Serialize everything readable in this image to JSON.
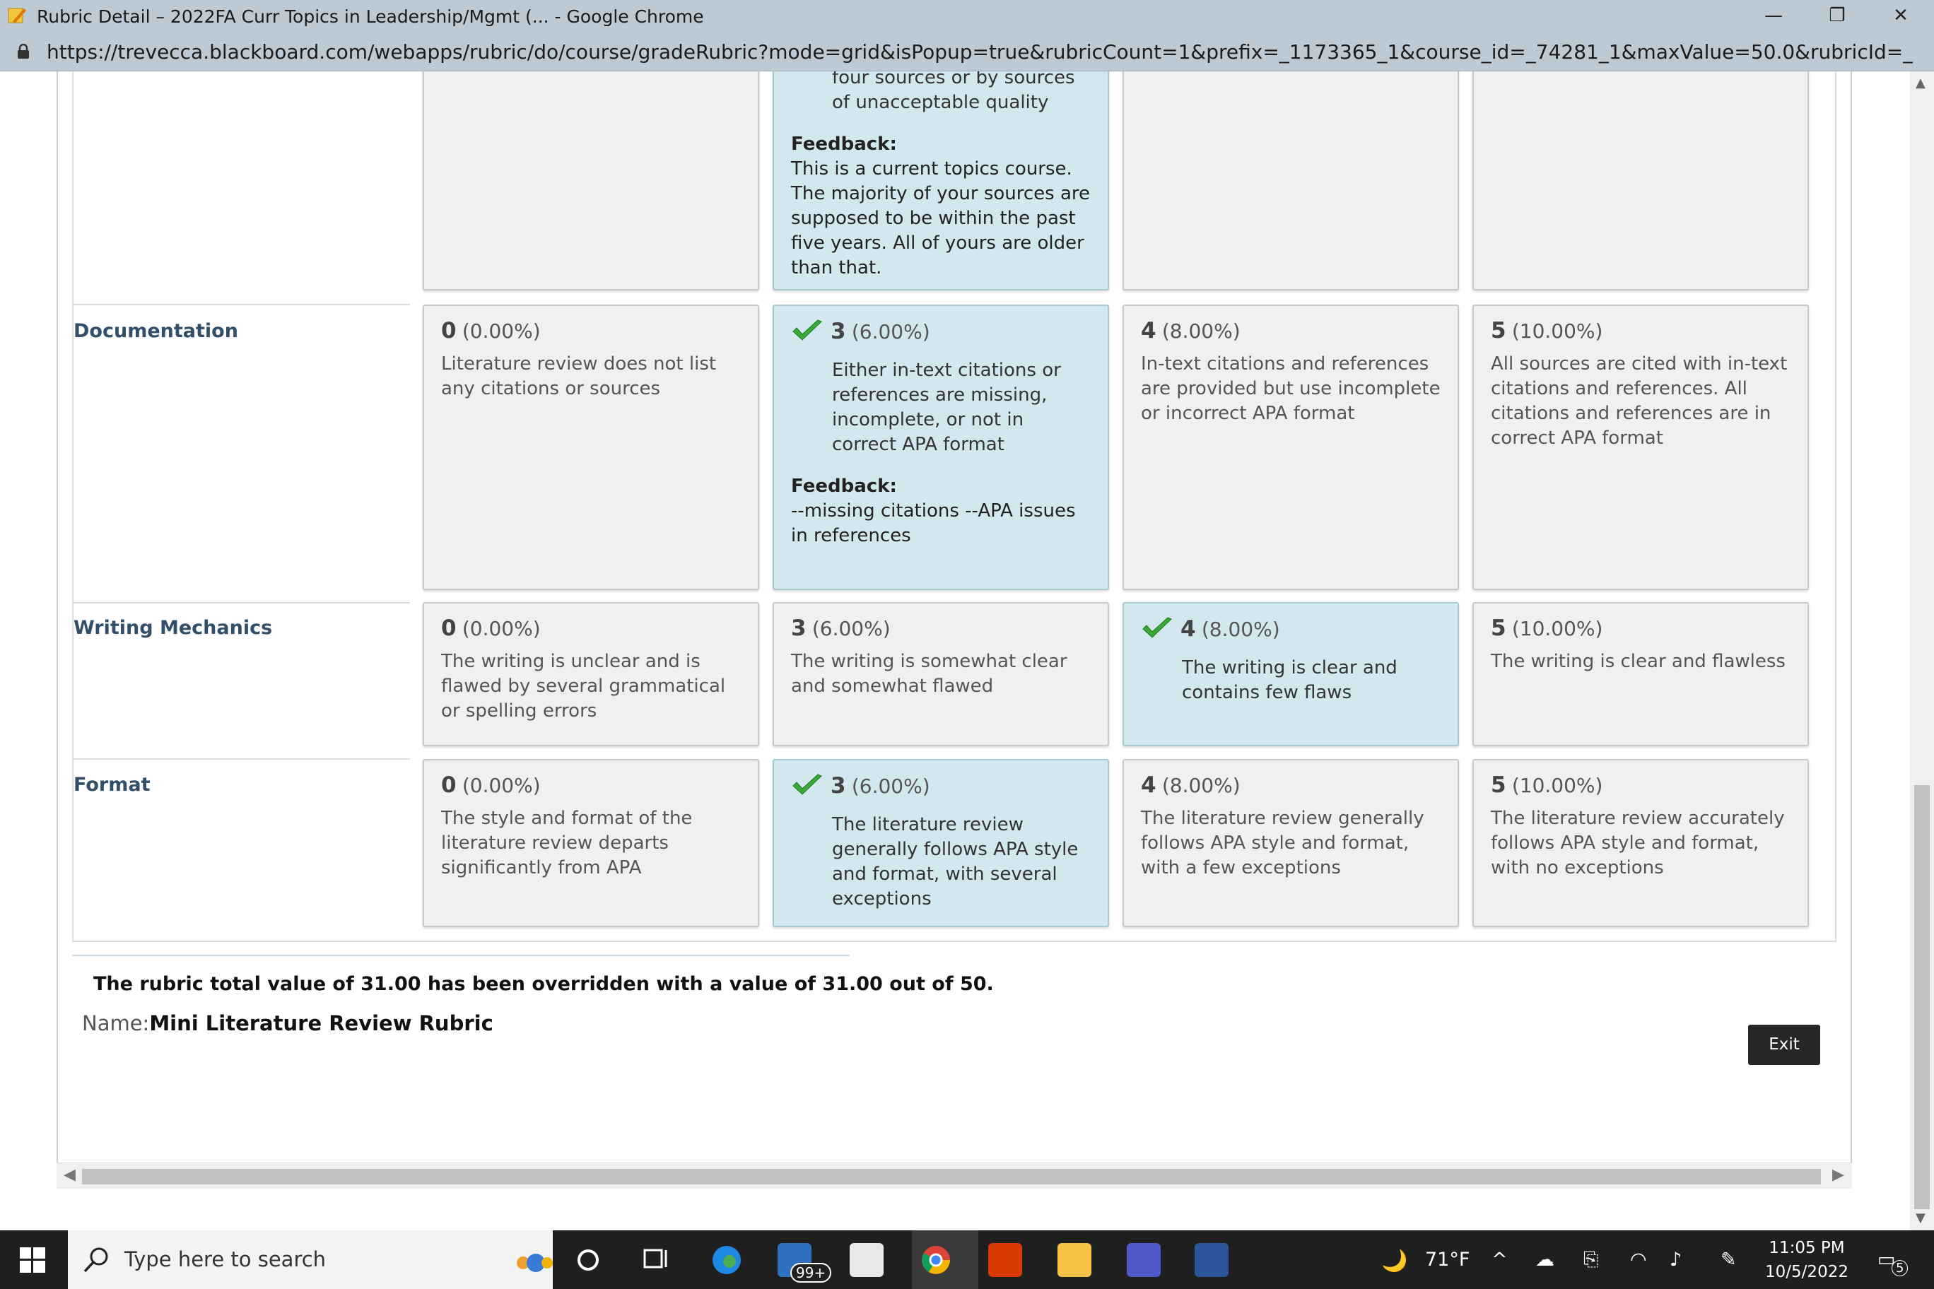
{
  "window": {
    "title": "Rubric Detail – 2022FA Curr Topics in Leadership/Mgmt (... - Google Chrome",
    "url": "https://trevecca.blackboard.com/webapps/rubric/do/course/gradeRubric?mode=grid&isPopup=true&rubricCount=1&prefix=_1173365_1&course_id=_74281_1&maxValue=50.0&rubricId=_42089_1&viewOnly=tr..."
  },
  "partial_row": {
    "selected_text_fragment": "four sources or by sources of unacceptable quality",
    "feedback_label": "Feedback:",
    "feedback_text": "This is a current topics course. The majority of your sources are supposed to be within the past five years. All of yours are older than that."
  },
  "rows": [
    {
      "criterion": "Documentation",
      "cells": [
        {
          "score": "0",
          "pct": "(0.00%)",
          "desc": "Literature review does not list any citations or sources",
          "selected": false
        },
        {
          "score": "3",
          "pct": "(6.00%)",
          "desc": "Either in-text citations or references are missing, incomplete, or not in correct APA format",
          "selected": true,
          "feedback_label": "Feedback:",
          "feedback": "--missing citations --APA issues in references"
        },
        {
          "score": "4",
          "pct": "(8.00%)",
          "desc": "In-text citations and references are provided but use incomplete or incorrect APA format",
          "selected": false
        },
        {
          "score": "5",
          "pct": "(10.00%)",
          "desc": "All sources are cited with in-text citations and references. All citations and references are in correct APA format",
          "selected": false
        }
      ]
    },
    {
      "criterion": "Writing Mechanics",
      "cells": [
        {
          "score": "0",
          "pct": "(0.00%)",
          "desc": "The writing is unclear and is flawed by several grammatical or spelling errors",
          "selected": false
        },
        {
          "score": "3",
          "pct": "(6.00%)",
          "desc": "The writing is somewhat clear and somewhat flawed",
          "selected": false
        },
        {
          "score": "4",
          "pct": "(8.00%)",
          "desc": "The writing is clear and contains few flaws",
          "selected": true
        },
        {
          "score": "5",
          "pct": "(10.00%)",
          "desc": "The writing is clear and flawless",
          "selected": false
        }
      ]
    },
    {
      "criterion": "Format",
      "cells": [
        {
          "score": "0",
          "pct": "(0.00%)",
          "desc": "The style and format of the literature review departs significantly from APA",
          "selected": false
        },
        {
          "score": "3",
          "pct": "(6.00%)",
          "desc": "The literature review generally follows APA style and format, with several exceptions",
          "selected": true
        },
        {
          "score": "4",
          "pct": "(8.00%)",
          "desc": "The literature review generally follows APA style and format, with a few exceptions",
          "selected": false
        },
        {
          "score": "5",
          "pct": "(10.00%)",
          "desc": "The literature review accurately follows APA style and format, with no exceptions",
          "selected": false
        }
      ]
    }
  ],
  "summary": {
    "total_text": "The rubric total value of 31.00 has been overridden with a value of 31.00 out of 50.",
    "name_label": "Name:",
    "name_value": "Mini Literature Review Rubric",
    "exit_label": "Exit"
  },
  "taskbar": {
    "search_placeholder": "Type here to search",
    "mail_badge": "99+",
    "weather": "71°F",
    "time": "11:05 PM",
    "date": "10/5/2022",
    "notifications": "5"
  }
}
